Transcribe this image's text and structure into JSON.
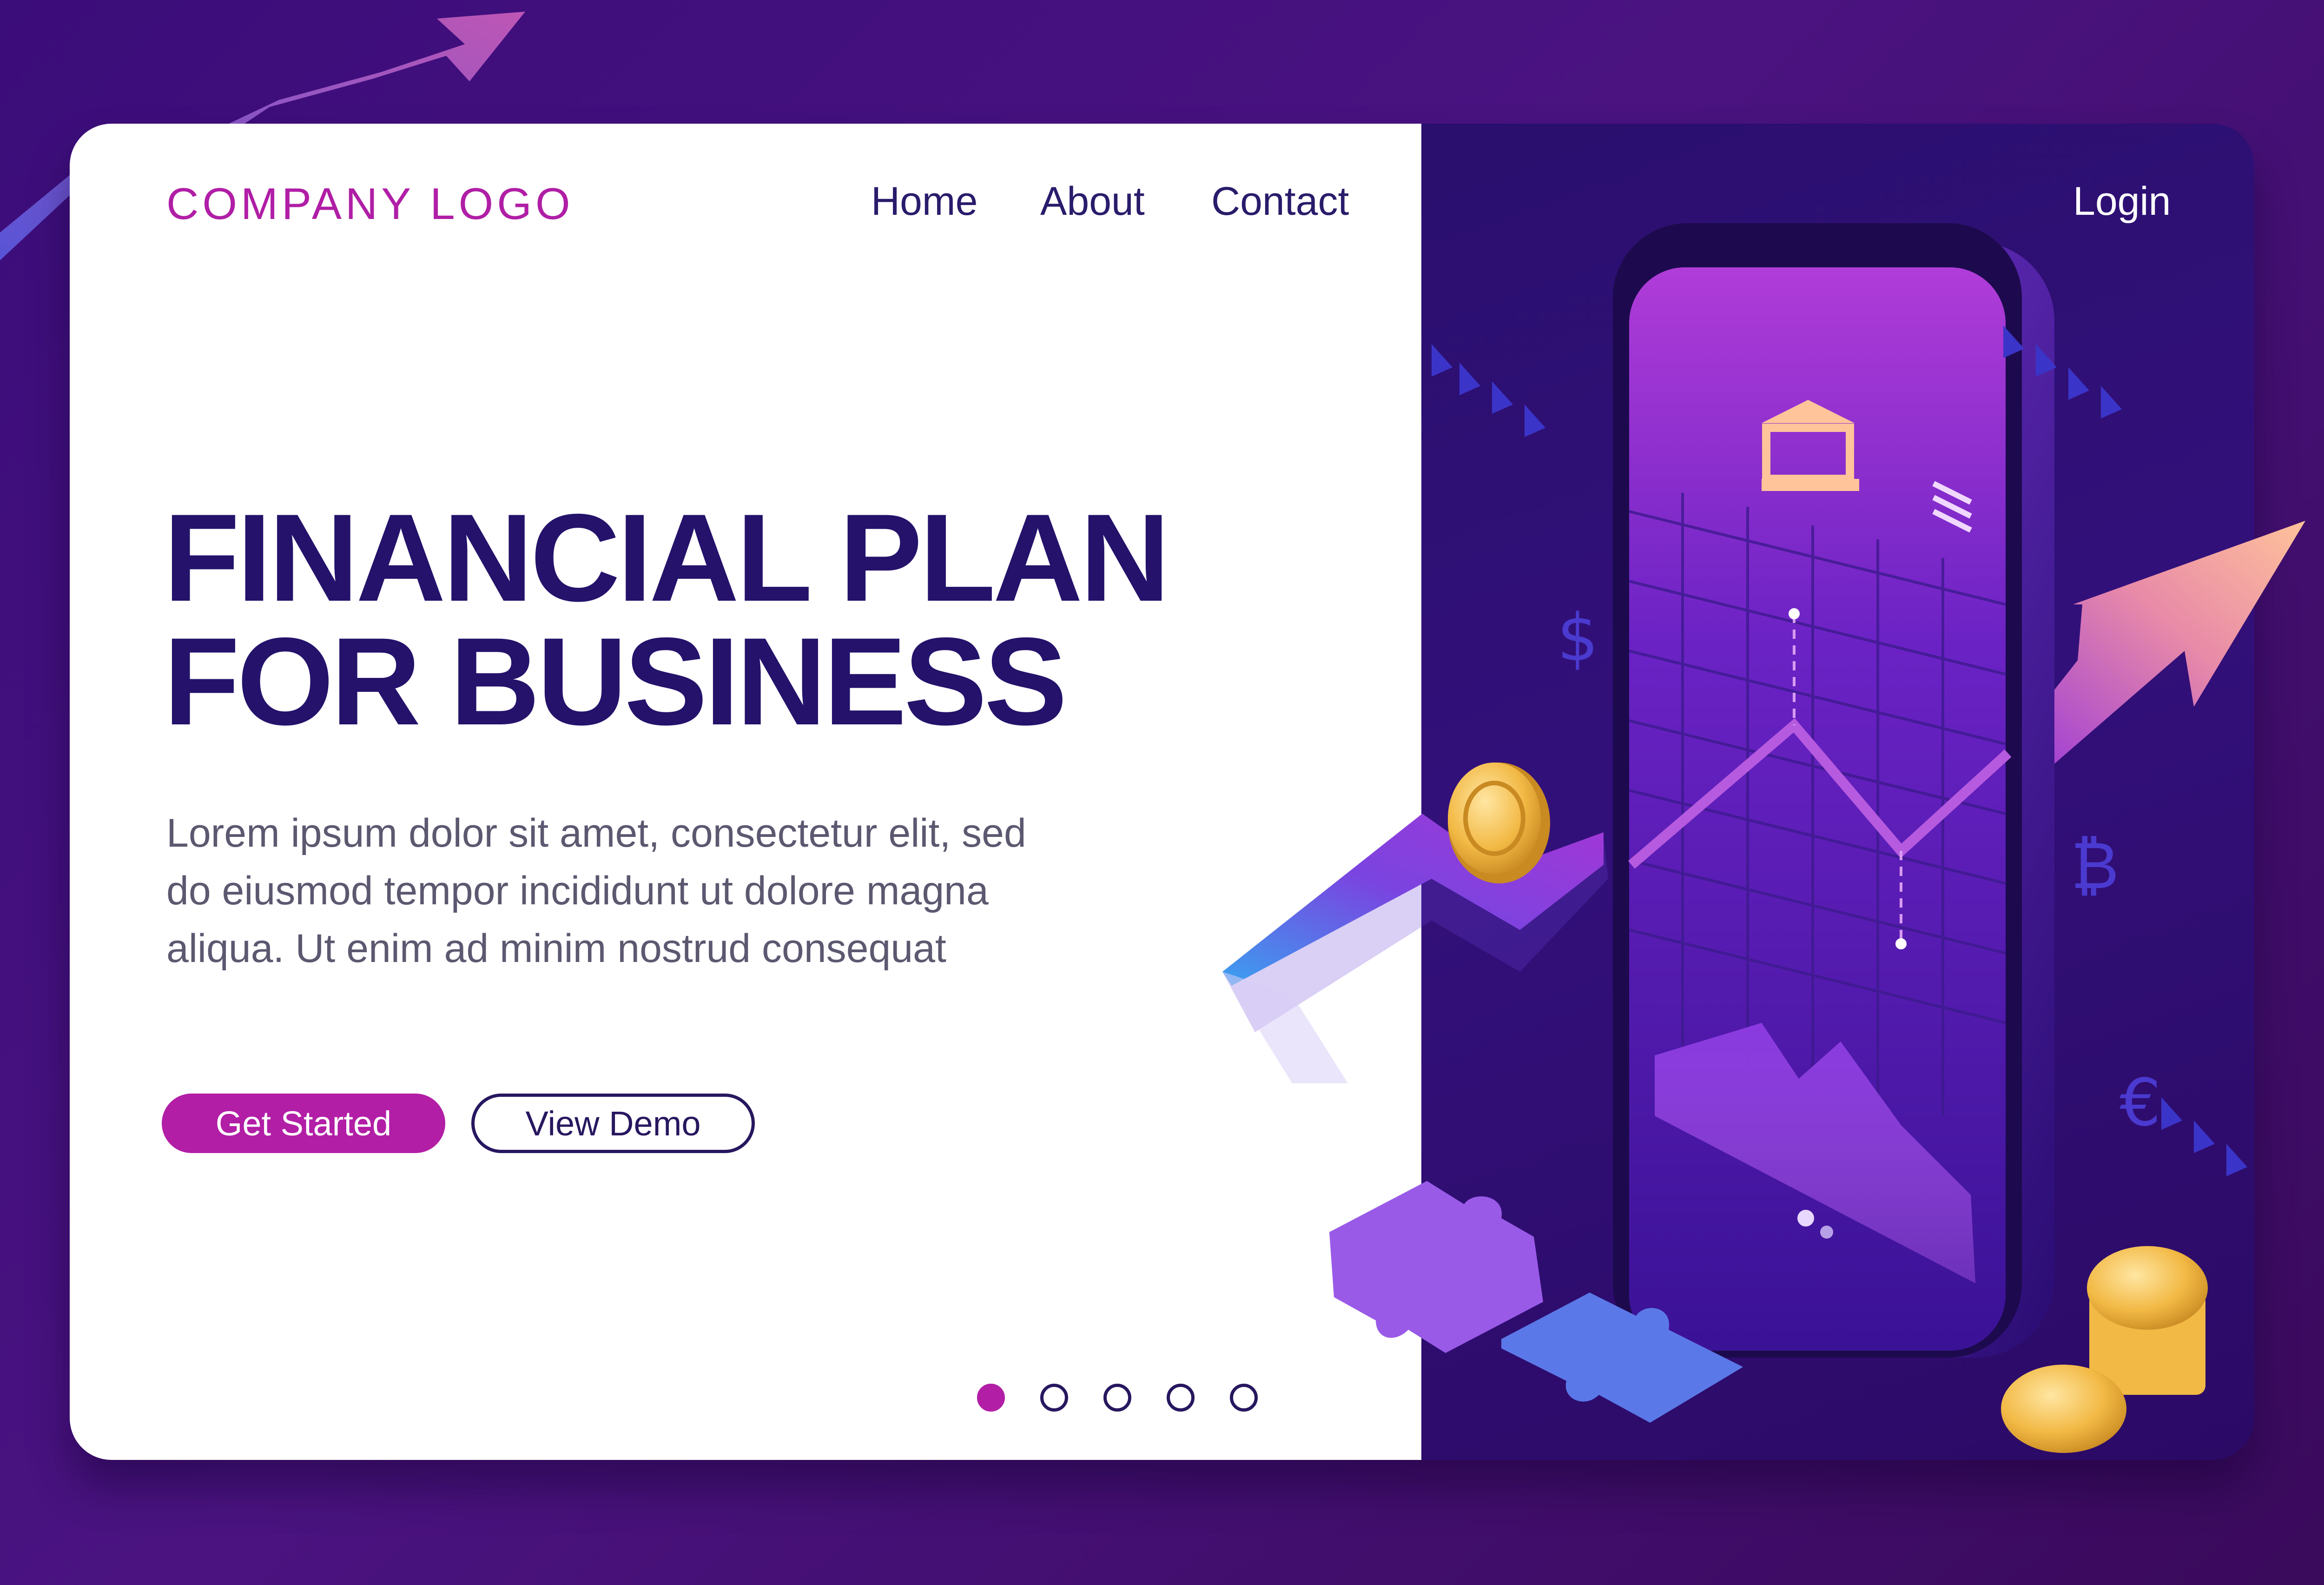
{
  "header": {
    "logo": "COMPANY LOGO",
    "nav": {
      "home": "Home",
      "about": "About",
      "contact": "Contact"
    },
    "login": "Login"
  },
  "hero": {
    "title_line1": "FINANCIAL PLAN",
    "title_line2": "FOR BUSINESS",
    "body": "Lorem ipsum dolor sit amet, consectetur elit, sed do eiusmod tempor incididunt ut dolore magna aliqua. Ut enim ad minim nostrud consequat",
    "primary_button": "Get Started",
    "secondary_button": "View Demo"
  },
  "pagination": {
    "total": 5,
    "active": 1
  },
  "illustration": {
    "currency_symbols": [
      "$",
      "₿",
      "€"
    ]
  },
  "colors": {
    "accent": "#b21ea6",
    "heading": "#24126b",
    "background": "#3b0d7a",
    "panel": "#2a0f6e",
    "gold": "#f2b945"
  },
  "icons": [
    "bank-icon",
    "menu-icon",
    "growth-arrow-icon",
    "coin-icon",
    "puzzle-piece-icon",
    "dollar-icon",
    "bitcoin-icon",
    "euro-icon"
  ]
}
